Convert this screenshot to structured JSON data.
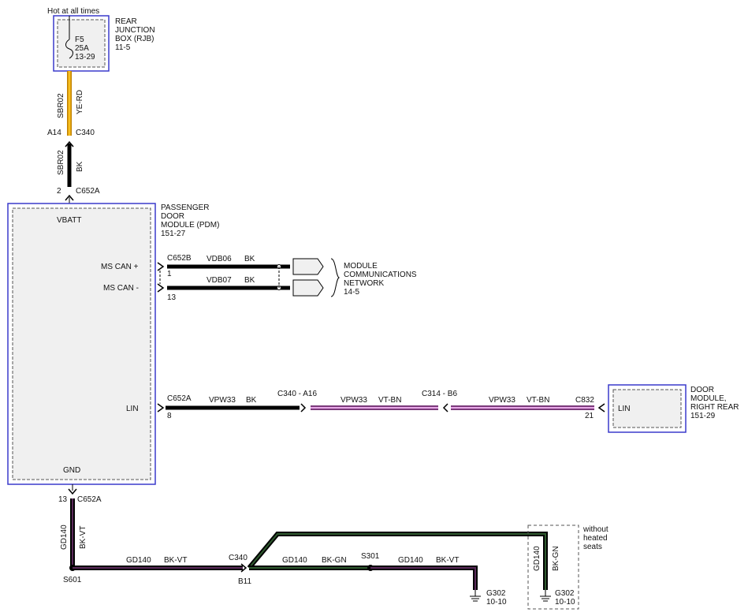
{
  "colors": {
    "module_border": "#3a3acc",
    "module_fill": "#f0f0f0",
    "wire_black": "#000000",
    "wire_yellow_red": "#f0a020",
    "wire_violet_brown": "#b070b0",
    "wire_black_violet": "#3a1a3a",
    "wire_black_green": "#1e3a1e"
  },
  "fuse": {
    "header": "Hot at all times",
    "name": "F5",
    "rating": "25A",
    "ref": "13-29",
    "box_line1": "REAR",
    "box_line2": "JUNCTION",
    "box_line3": "BOX (RJB)",
    "box_ref": "11-5"
  },
  "power_feed": {
    "upper_circuit": "SBR02",
    "upper_color": "YE-RD",
    "connector_pin": "A14",
    "connector": "C340",
    "lower_circuit": "SBR02",
    "lower_color": "BK",
    "pdm_pin": "2",
    "pdm_connector": "C652A"
  },
  "pdm": {
    "line1": "PASSENGER",
    "line2": "DOOR",
    "line3": "MODULE (PDM)",
    "ref": "151-27",
    "vbatt": "VBATT",
    "ms_can_plus": "MS CAN +",
    "ms_can_minus": "MS CAN -",
    "lin": "LIN",
    "gnd": "GND"
  },
  "can_bus": {
    "connector": "C652B",
    "plus_pin": "1",
    "minus_pin": "13",
    "plus_circuit": "VDB06",
    "plus_color": "BK",
    "minus_circuit": "VDB07",
    "minus_color": "BK",
    "network_line1": "MODULE",
    "network_line2": "COMMUNICATIONS",
    "network_line3": "NETWORK",
    "network_ref": "14-5"
  },
  "lin_bus": {
    "pdm_connector": "C652A",
    "pdm_pin": "8",
    "seg1_circuit": "VPW33",
    "seg1_color": "BK",
    "inline1": "C340 - A16",
    "seg2_circuit": "VPW33",
    "seg2_color": "VT-BN",
    "inline2": "C314 - B6",
    "seg3_circuit": "VPW33",
    "seg3_color": "VT-BN",
    "rr_connector": "C832",
    "rr_pin": "21",
    "rr_lin": "LIN",
    "rr_line1": "DOOR",
    "rr_line2": "MODULE,",
    "rr_line3": "RIGHT REAR",
    "rr_ref": "151-29"
  },
  "ground": {
    "pdm_pin": "13",
    "pdm_connector": "C652A",
    "vert_circuit": "GD140",
    "vert_color": "BK-VT",
    "splice1": "S601",
    "h1_circuit": "GD140",
    "h1_color": "BK-VT",
    "connector": "C340",
    "connector_pin": "B11",
    "h2_circuit": "GD140",
    "h2_color": "BK-GN",
    "splice2": "S301",
    "h3_circuit": "GD140",
    "h3_color": "BK-VT",
    "g1_name": "G302",
    "g1_ref": "10-10",
    "option_line1": "without",
    "option_line2": "heated",
    "option_line3": "seats",
    "opt_circuit": "GD140",
    "opt_color": "BK-GN",
    "g2_name": "G302",
    "g2_ref": "10-10"
  }
}
